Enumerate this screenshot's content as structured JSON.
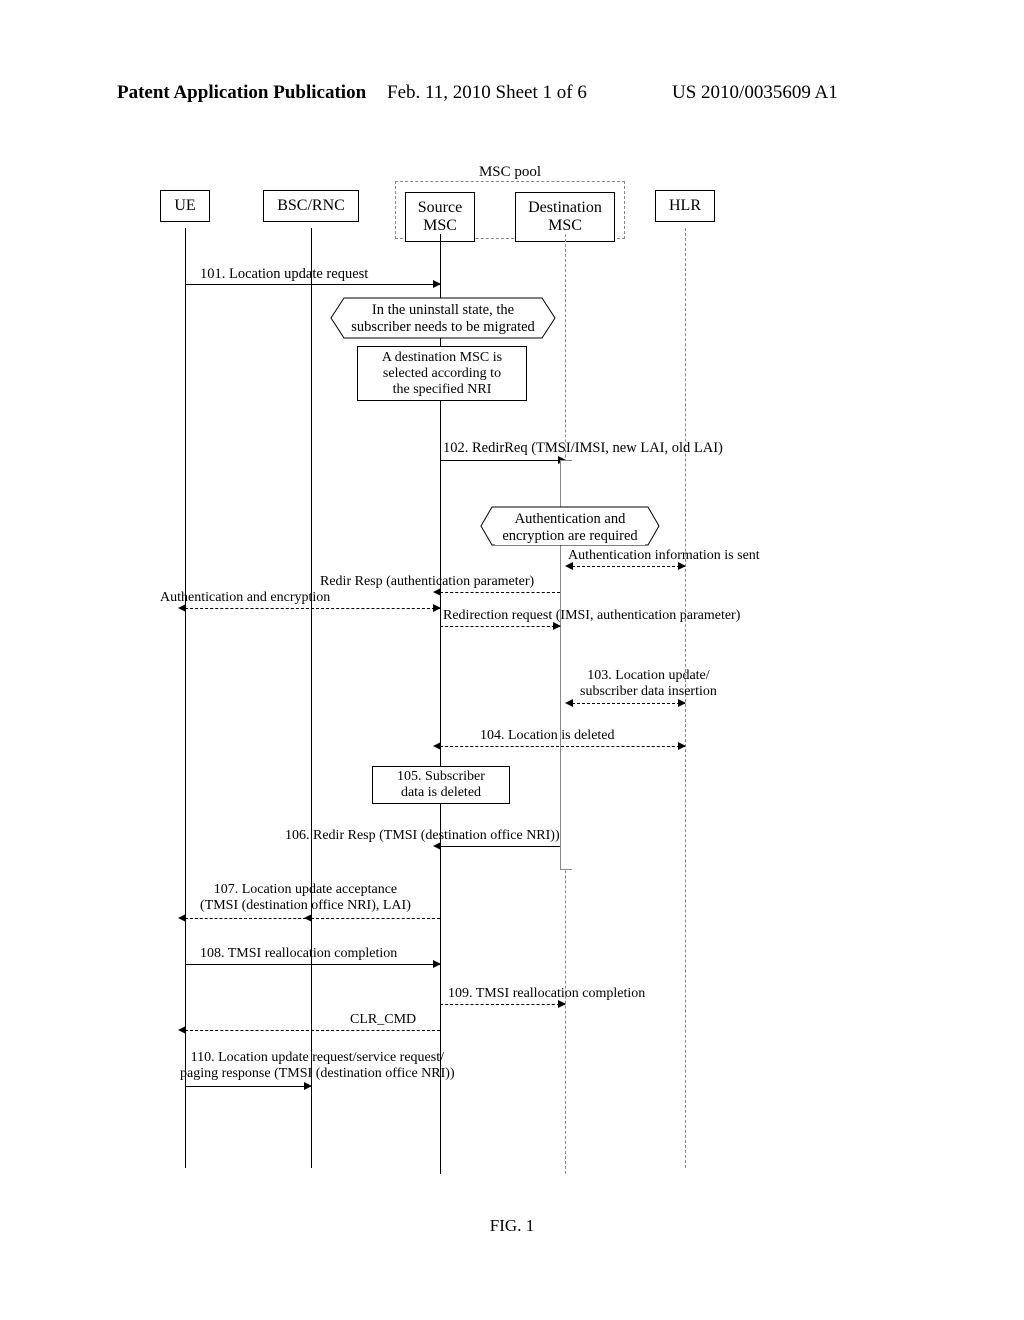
{
  "header": {
    "left": "Patent Application Publication",
    "mid": "Feb. 11, 2010   Sheet 1 of 6",
    "right": "US 2010/0035609 A1"
  },
  "frame_label": "MSC pool",
  "actors": {
    "ue": "UE",
    "bsc": "BSC/RNC",
    "src": "Source\nMSC",
    "dst": "Destination\nMSC",
    "hlr": "HLR"
  },
  "notes": {
    "uninstall": "In the uninstall state, the\nsubscriber needs to be migrated",
    "select_dest": "A destination MSC is\nselected according to\nthe specified NRI",
    "auth_req": "Authentication and\nencryption are required"
  },
  "msgs": {
    "m101": "101. Location update request",
    "m102": "102. RedirReq (TMSI/IMSI, new LAI, old LAI)",
    "auth_info": "Authentication information is sent",
    "redir_resp_auth": "Redir Resp (authentication parameter)",
    "ue_auth": "Authentication and encryption",
    "redir_req_imsi": "Redirection request (IMSI, authentication parameter)",
    "m103": "103. Location update/\nsubscriber data insertion",
    "m104": "104. Location is deleted",
    "m105": "105. Subscriber\ndata is deleted",
    "m106": "106. Redir Resp (TMSI (destination office NRI))",
    "m107": "107. Location update acceptance\n(TMSI (destination office NRI), LAI)",
    "m108": "108. TMSI reallocation completion",
    "m109": "109. TMSI reallocation completion",
    "clr": "CLR_CMD",
    "m110": "110. Location update request/service request/\npaging response (TMSI (destination office NRI))"
  },
  "figure_caption": "FIG. 1",
  "chart_data": {
    "type": "table",
    "title": "Sequence diagram message flow",
    "actors": [
      "UE",
      "BSC/RNC",
      "Source MSC",
      "Destination MSC",
      "HLR"
    ],
    "messages": [
      {
        "n": 101,
        "from": "UE",
        "to": "Source MSC",
        "label": "Location update request"
      },
      {
        "from": "Source MSC",
        "to": "Source MSC",
        "note": "In the uninstall state, the subscriber needs to be migrated"
      },
      {
        "from": "Source MSC",
        "to": "Source MSC",
        "note": "A destination MSC is selected according to the specified NRI"
      },
      {
        "n": 102,
        "from": "Source MSC",
        "to": "Destination MSC",
        "label": "RedirReq (TMSI/IMSI, new LAI, old LAI)"
      },
      {
        "from": "Destination MSC",
        "to": "Destination MSC",
        "note": "Authentication and encryption are required"
      },
      {
        "from": "Destination MSC",
        "to": "HLR",
        "label": "Authentication information is sent",
        "bidir": true
      },
      {
        "from": "Destination MSC",
        "to": "Source MSC",
        "label": "Redir Resp (authentication parameter)",
        "dashed": true
      },
      {
        "from": "Source MSC",
        "to": "UE",
        "label": "Authentication and encryption",
        "bidir": true,
        "dashed": true
      },
      {
        "from": "Source MSC",
        "to": "Destination MSC",
        "label": "Redirection request (IMSI, authentication parameter)",
        "dashed": true
      },
      {
        "n": 103,
        "from": "Destination MSC",
        "to": "HLR",
        "label": "Location update / subscriber data insertion",
        "bidir": true,
        "dashed": true
      },
      {
        "n": 104,
        "from": "HLR",
        "to": "Source MSC",
        "label": "Location is deleted",
        "bidir": true,
        "dashed": true
      },
      {
        "n": 105,
        "from": "Source MSC",
        "to": "Source MSC",
        "label": "Subscriber data is deleted"
      },
      {
        "n": 106,
        "from": "Destination MSC",
        "to": "Source MSC",
        "label": "Redir Resp (TMSI (destination office NRI))"
      },
      {
        "n": 107,
        "from": "Source MSC",
        "to": "UE",
        "via": "BSC/RNC",
        "label": "Location update acceptance (TMSI (destination office NRI), LAI)",
        "dashed": true
      },
      {
        "n": 108,
        "from": "UE",
        "to": "Source MSC",
        "label": "TMSI reallocation completion"
      },
      {
        "n": 109,
        "from": "Source MSC",
        "to": "Destination MSC",
        "label": "TMSI reallocation completion",
        "dashed": true
      },
      {
        "from": "Source MSC",
        "to": "UE",
        "label": "CLR_CMD",
        "dashed": true
      },
      {
        "n": 110,
        "from": "UE",
        "to": "BSC/RNC",
        "label": "Location update request / service request / paging response (TMSI (destination office NRI))"
      }
    ]
  }
}
